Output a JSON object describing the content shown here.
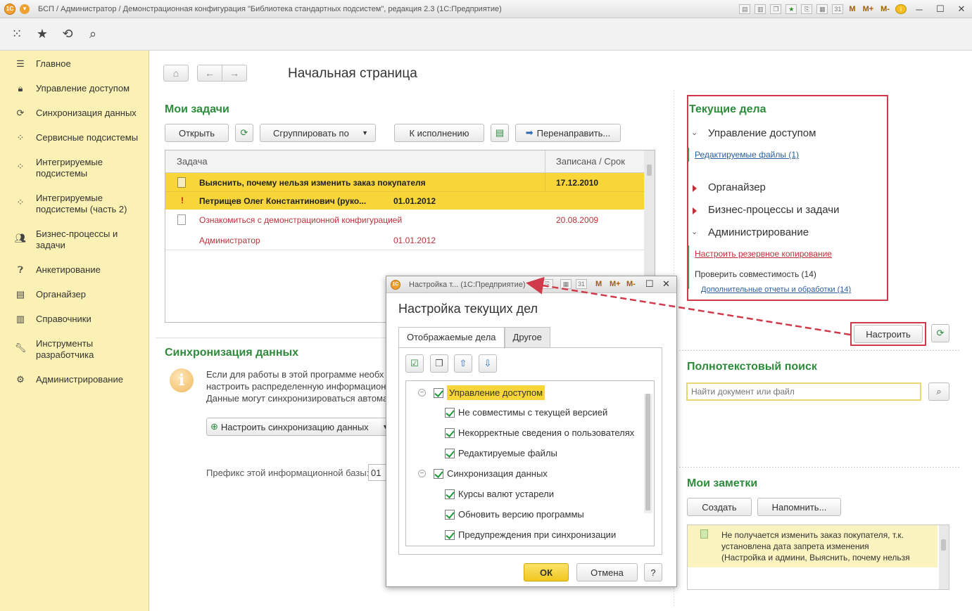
{
  "window": {
    "title": "БСП / Администратор / Демонстрационная конфигурация \"Библиотека стандартных подсистем\", редакция 2.3  (1С:Предприятие)",
    "memory_buttons": [
      "M",
      "M+",
      "M-"
    ]
  },
  "sidebar": {
    "items": [
      {
        "label": "Главное",
        "icon": "menu-lines-icon"
      },
      {
        "label": "Управление доступом",
        "icon": "lock-icon"
      },
      {
        "label": "Синхронизация данных",
        "icon": "sync-icon"
      },
      {
        "label": "Сервисные подсистемы",
        "icon": "grid-icon"
      },
      {
        "label": "Интегрируемые подсистемы",
        "icon": "grid-icon"
      },
      {
        "label": "Интегрируемые подсистемы (часть 2)",
        "icon": "grid-icon"
      },
      {
        "label": "Бизнес-процессы и задачи",
        "icon": "users-icon"
      },
      {
        "label": "Анкетирование",
        "icon": "question-icon"
      },
      {
        "label": "Органайзер",
        "icon": "notebook-icon"
      },
      {
        "label": "Справочники",
        "icon": "books-icon"
      },
      {
        "label": "Инструменты разработчика",
        "icon": "wrench-icon"
      },
      {
        "label": "Администрирование",
        "icon": "gear-icon"
      }
    ]
  },
  "page": {
    "title": "Начальная страница"
  },
  "tasks": {
    "title": "Мои задачи",
    "buttons": {
      "open": "Открыть",
      "group_by": "Сгруппировать по",
      "to_execution": "К исполнению",
      "redirect": "Перенаправить..."
    },
    "columns": [
      "Задача",
      "Записана / Срок"
    ],
    "rows": [
      {
        "task": "Выяснить, почему нельзя изменить заказ покупателя",
        "date": "17.12.2010",
        "sub": "Петрищев Олег Константинович (руко...",
        "subdate": "01.01.2012",
        "highlight": true
      },
      {
        "task": "Ознакомиться с демонстрационной конфигурацией",
        "date": "20.08.2009",
        "sub": "Администратор",
        "subdate": "01.01.2012",
        "highlight": false
      }
    ]
  },
  "sync": {
    "title": "Синхронизация данных",
    "text": [
      "Если для работы в этой программе необх",
      "настроить распределенную информацион",
      "Данные могут синхронизироваться автома"
    ],
    "button": "Настроить синхронизацию данных",
    "prefix_label": "Префикс этой информационной базы:",
    "prefix_value": "01"
  },
  "current": {
    "title": "Текущие дела",
    "groups": [
      {
        "label": "Управление доступом",
        "expanded": true
      },
      {
        "label": "Органайзер",
        "expanded": false
      },
      {
        "label": "Бизнес-процессы и задачи",
        "expanded": false
      },
      {
        "label": "Администрирование",
        "expanded": true
      }
    ],
    "access_link": "Редактируемые файлы (1)",
    "admin_link1": "Настроить резервное копирование",
    "admin_text": "Проверить совместимость (14)",
    "admin_link2": "Дополнительные отчеты и обработки (14)",
    "configure_button": "Настроить"
  },
  "search": {
    "title": "Полнотекстовый поиск",
    "placeholder": "Найти документ или файл"
  },
  "notes": {
    "title": "Мои заметки",
    "create": "Создать",
    "remind": "Напомнить...",
    "lines": [
      "Не получается изменить заказ покупателя, т.к.",
      "установлена дата запрета изменения",
      "(Настройка и админи, Выяснить, почему нельзя"
    ]
  },
  "dialog": {
    "titlebar": "Настройка т...  (1С:Предприятие)",
    "heading": "Настройка текущих дел",
    "tabs": [
      "Отображаемые дела",
      "Другое"
    ],
    "tree": [
      {
        "label": "Управление доступом",
        "level": 0
      },
      {
        "label": "Не совместимы с текущей версией",
        "level": 1
      },
      {
        "label": "Некорректные сведения о пользователях",
        "level": 1
      },
      {
        "label": "Редактируемые файлы",
        "level": 1
      },
      {
        "label": "Синхронизация данных",
        "level": 0
      },
      {
        "label": "Курсы валют устарели",
        "level": 1
      },
      {
        "label": "Обновить версию программы",
        "level": 1
      },
      {
        "label": "Предупреждения при синхронизации",
        "level": 1
      }
    ],
    "ok": "ОК",
    "cancel": "Отмена",
    "help": "?"
  },
  "colors": {
    "accent_green": "#2e8b3c",
    "highlight_yellow": "#f8d63a",
    "annotation_red": "#d03a4a",
    "sidebar_bg": "#fbf1b4"
  }
}
